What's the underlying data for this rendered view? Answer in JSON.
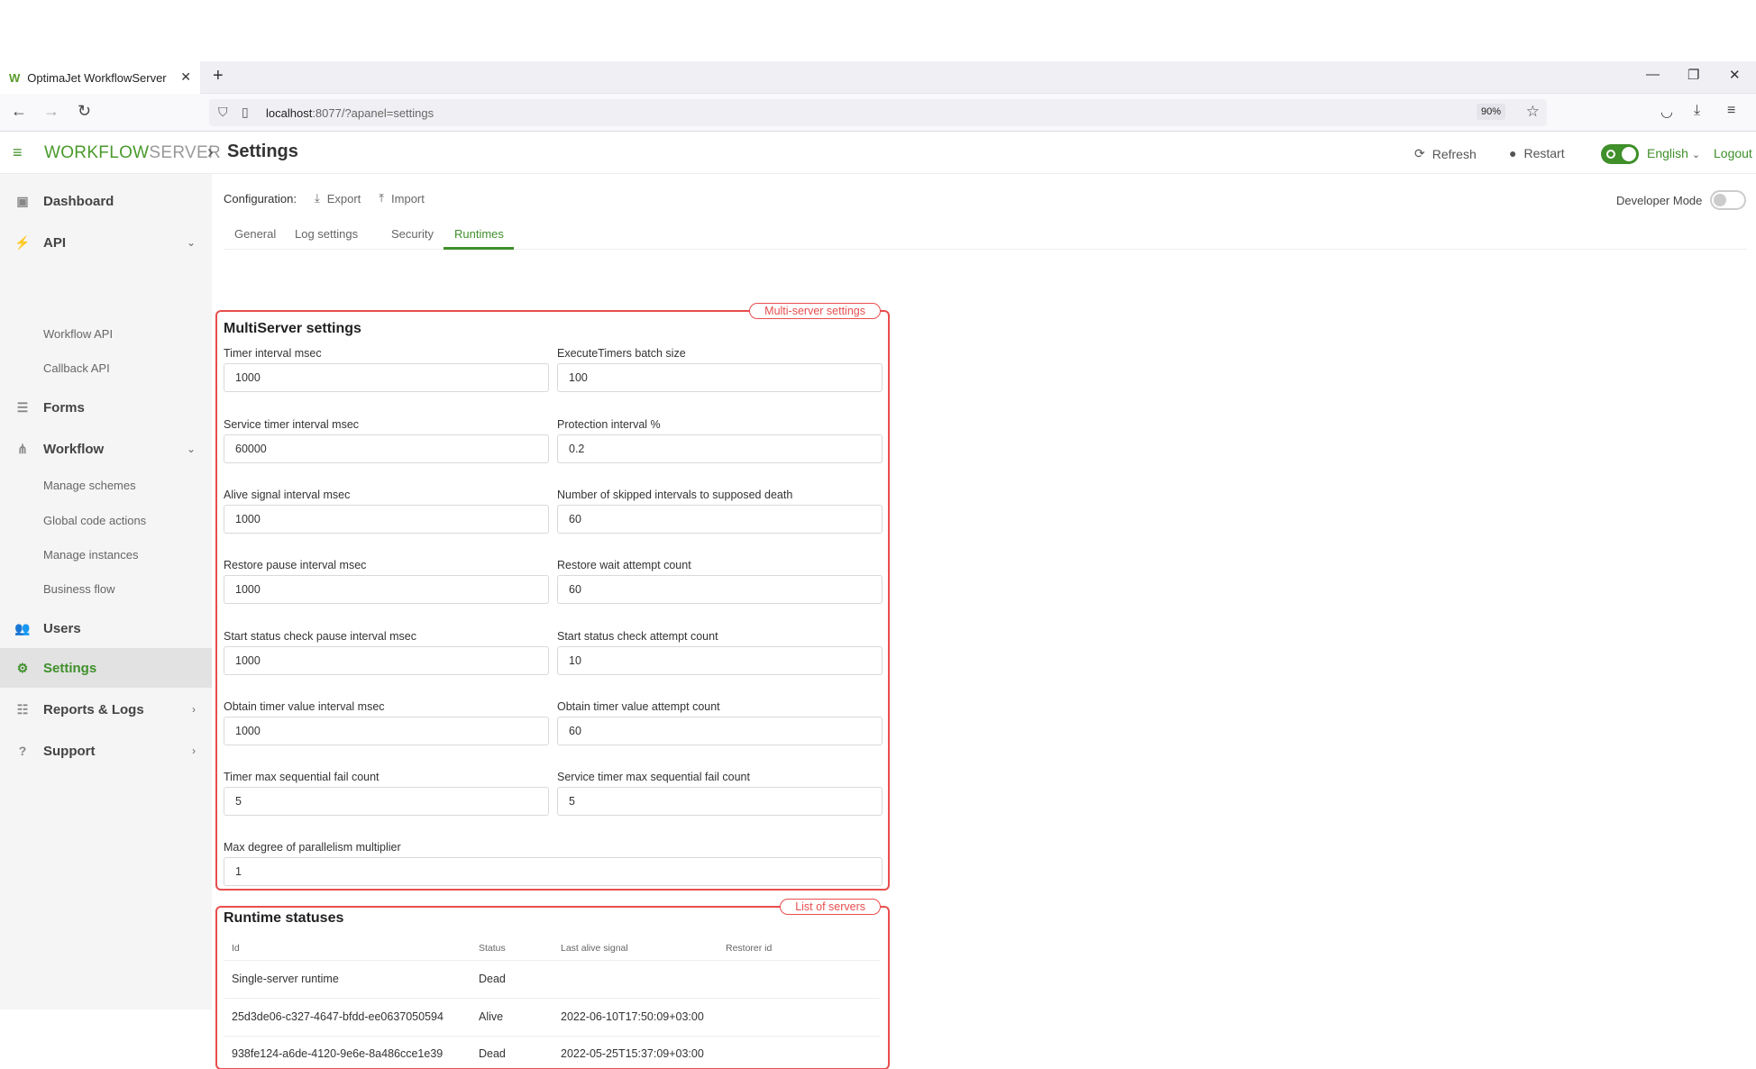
{
  "browser": {
    "tab_title": "OptimaJet WorkflowServer",
    "url_host": "localhost",
    "url_rest": ":8077/?apanel=settings",
    "zoom": "90%"
  },
  "header": {
    "logo_workflow": "WORKFLOW",
    "logo_server": "SERVER",
    "breadcrumb_sep": "›",
    "title": "Settings",
    "refresh": "Refresh",
    "restart": "Restart",
    "language": "English",
    "logout": "Logout"
  },
  "sidebar": {
    "dashboard": "Dashboard",
    "api": "API",
    "workflow_api": "Workflow API",
    "callback_api": "Callback API",
    "forms": "Forms",
    "workflow": "Workflow",
    "manage_schemes": "Manage schemes",
    "global_code_actions": "Global code actions",
    "manage_instances": "Manage instances",
    "business_flow": "Business flow",
    "users": "Users",
    "settings": "Settings",
    "reports_logs": "Reports & Logs",
    "support": "Support"
  },
  "toolbar": {
    "configuration": "Configuration:",
    "export": "Export",
    "import": "Import",
    "developer_mode": "Developer Mode"
  },
  "tabs": [
    "General",
    "Log settings",
    "Security",
    "Runtimes"
  ],
  "multiserver": {
    "tag": "Multi-server settings",
    "title": "MultiServer settings",
    "fields": [
      {
        "label": "Timer interval msec",
        "value": "1000"
      },
      {
        "label": "ExecuteTimers batch size",
        "value": "100"
      },
      {
        "label": "Service timer interval msec",
        "value": "60000"
      },
      {
        "label": "Protection interval %",
        "value": "0.2"
      },
      {
        "label": "Alive signal interval msec",
        "value": "1000"
      },
      {
        "label": "Number of skipped intervals to supposed death",
        "value": "60"
      },
      {
        "label": "Restore pause interval msec",
        "value": "1000"
      },
      {
        "label": "Restore wait attempt count",
        "value": "60"
      },
      {
        "label": "Start status check pause interval msec",
        "value": "1000"
      },
      {
        "label": "Start status check attempt count",
        "value": "10"
      },
      {
        "label": "Obtain timer value interval msec",
        "value": "1000"
      },
      {
        "label": "Obtain timer value attempt count",
        "value": "60"
      },
      {
        "label": "Timer max sequential fail count",
        "value": "5"
      },
      {
        "label": "Service timer max sequential fail count",
        "value": "5"
      },
      {
        "label": "Max degree of parallelism multiplier",
        "value": "1"
      }
    ]
  },
  "runtimes": {
    "tag": "List of servers",
    "title": "Runtime statuses",
    "columns": [
      "Id",
      "Status",
      "Last alive signal",
      "Restorer id"
    ],
    "rows": [
      {
        "id": "Single-server runtime",
        "status": "Dead",
        "last": "",
        "restorer": ""
      },
      {
        "id": "25d3de06-c327-4647-bfdd-ee0637050594",
        "status": "Alive",
        "last": "2022-06-10T17:50:09+03:00",
        "restorer": ""
      },
      {
        "id": "938fe124-a6de-4120-9e6e-8a486cce1e39",
        "status": "Dead",
        "last": "2022-05-25T15:37:09+03:00",
        "restorer": ""
      }
    ]
  }
}
